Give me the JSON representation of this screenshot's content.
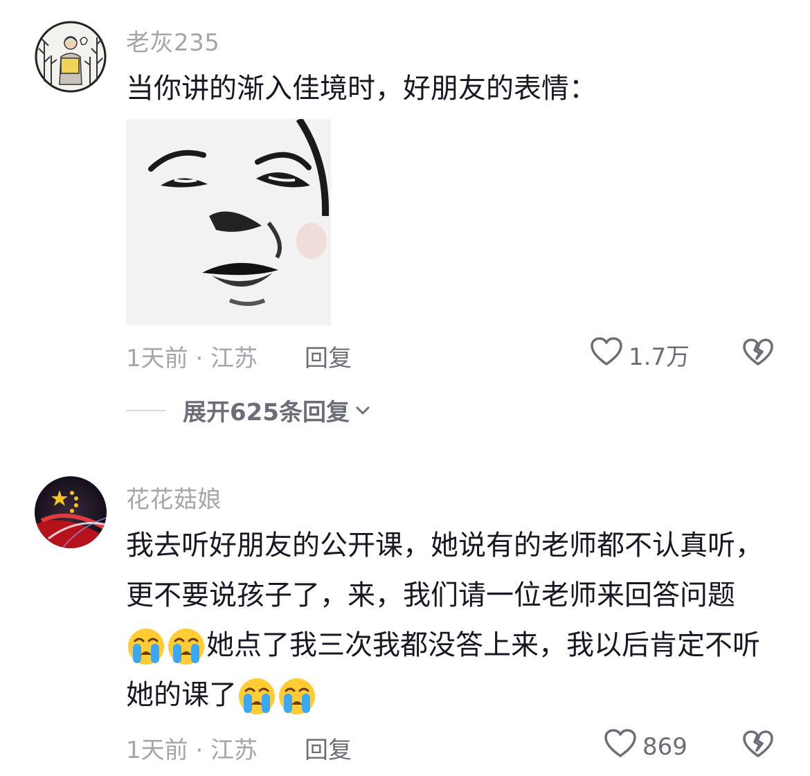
{
  "comments": [
    {
      "username": "老灰235",
      "text": "当你讲的渐入佳境时，好朋友的表情：",
      "time_location": "1天前 · 江苏",
      "reply_label": "回复",
      "like_count": "1.7万",
      "expand_label": "展开625条回复"
    },
    {
      "username": "花花菇娘",
      "text_parts": [
        "我去听好朋友的公开课，她说有的老师都不认真听，更不要说孩子了，来，我们请一位老师来回答问题",
        "她点了我三次我都没答上来，我以后肯定不听她的课了"
      ],
      "time_location": "1天前 · 江苏",
      "reply_label": "回复",
      "like_count": "869"
    }
  ],
  "icons": {
    "like": "heart-outline-icon",
    "dislike": "broken-heart-icon",
    "expand": "chevron-down-icon",
    "emoji": "loudly-crying-face-emoji"
  },
  "colors": {
    "text_primary": "#161823",
    "text_secondary": "#a3a6ad",
    "action": "#6b6e76"
  }
}
